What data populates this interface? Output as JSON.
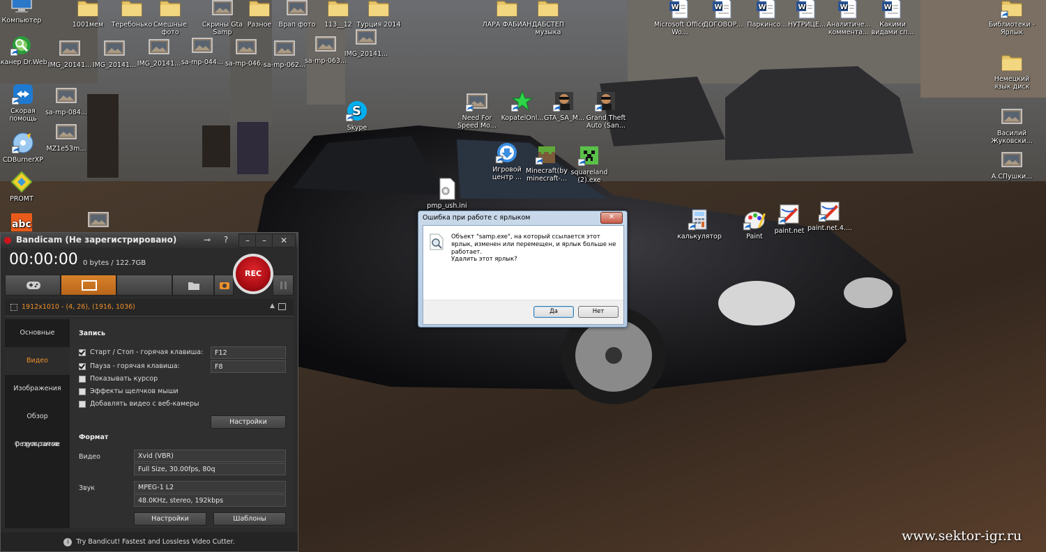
{
  "desktop": {
    "icons": [
      {
        "id": "computer",
        "label": "Компьютер"
      },
      {
        "id": "1001mem",
        "label": "1001мем"
      },
      {
        "id": "terebonko",
        "label": "Теребонько"
      },
      {
        "id": "funny",
        "label": "Смешные фото"
      },
      {
        "id": "gta-screens",
        "label": "Скрины Gta Samp"
      },
      {
        "id": "misc",
        "label": "Разное"
      },
      {
        "id": "vrap",
        "label": "Врап фото"
      },
      {
        "id": "113",
        "label": "113__12"
      },
      {
        "id": "turkey",
        "label": "Турция 2014"
      },
      {
        "id": "lara",
        "label": "ЛАРА ФАБИАН"
      },
      {
        "id": "dubstep",
        "label": "ДАБСТЕП музыка"
      },
      {
        "id": "msoffice",
        "label": "Microsoft Office Wo..."
      },
      {
        "id": "dogovor",
        "label": "ДОГОВОР..."
      },
      {
        "id": "parkinson",
        "label": "Паркинсо..."
      },
      {
        "id": "nutri",
        "label": "НУТРИЦЕ..."
      },
      {
        "id": "analit",
        "label": "Аналитиче... коммента..."
      },
      {
        "id": "kakimi",
        "label": "Какими видами сп..."
      },
      {
        "id": "libraries",
        "label": "Библиотеки - Ярлык"
      },
      {
        "id": "drweb",
        "label": "Сканер Dr.Web"
      },
      {
        "id": "img1",
        "label": "IMG_20141..."
      },
      {
        "id": "img2",
        "label": "IMG_20141..."
      },
      {
        "id": "img3",
        "label": "IMG_20141..."
      },
      {
        "id": "samp044",
        "label": "sa-mp-044..."
      },
      {
        "id": "samp046",
        "label": "sa-mp-046..."
      },
      {
        "id": "samp062",
        "label": "sa-mp-062..."
      },
      {
        "id": "samp063",
        "label": "sa-mp-063..."
      },
      {
        "id": "img4",
        "label": "IMG_20141..."
      },
      {
        "id": "german",
        "label": "Немецкий язык диск"
      },
      {
        "id": "teamviewer",
        "label": "Скорая помощь"
      },
      {
        "id": "samp084",
        "label": "sa-mp-084..."
      },
      {
        "id": "skype",
        "label": "Skype"
      },
      {
        "id": "nfs",
        "label": "Need For Speed Mo..."
      },
      {
        "id": "kopatel",
        "label": "KopatelOnl..."
      },
      {
        "id": "gtasam",
        "label": "GTA_SA_M..."
      },
      {
        "id": "gtasa",
        "label": "Grand Theft Auto (San..."
      },
      {
        "id": "vasily",
        "label": "Василий Жуковски..."
      },
      {
        "id": "cdburner",
        "label": "CDBurnerXP"
      },
      {
        "id": "mz1",
        "label": "MZ1e53m..."
      },
      {
        "id": "gamecenter",
        "label": "Игровой центр ..."
      },
      {
        "id": "minecraft",
        "label": "Minecraft(by minecraft-..."
      },
      {
        "id": "squareland",
        "label": "squareland (2).exe"
      },
      {
        "id": "pushkin",
        "label": "А.СПушки..."
      },
      {
        "id": "promt",
        "label": "PROMT"
      },
      {
        "id": "pmp",
        "label": "pmp_ush.ini"
      },
      {
        "id": "calc",
        "label": "калькулятор"
      },
      {
        "id": "paint",
        "label": "Paint"
      },
      {
        "id": "paintnet",
        "label": "paint.net"
      },
      {
        "id": "paintnet4",
        "label": "paint.net.4...."
      },
      {
        "id": "abc",
        "label": ""
      },
      {
        "id": "photo",
        "label": ""
      }
    ]
  },
  "bandicam": {
    "title": "Bandicam (Не зарегистрировано)",
    "timer": "00:00:00",
    "size": "0 bytes / 122.7GB",
    "rec_label": "REC",
    "region": "1912x1010 - (4, 26), (1916, 1036)",
    "sidebar": [
      "Основные",
      "Видео",
      "Изображения",
      "Обзор результатов",
      "О программе"
    ],
    "sidebar_active": "Видео",
    "record": {
      "heading": "Запись",
      "start_stop_label": "Старт / Стоп - горячая клавиша:",
      "start_stop_key": "F12",
      "pause_label": "Пауза - горячая клавиша:",
      "pause_key": "F8",
      "show_cursor": "Показывать курсор",
      "click_effects": "Эффекты щелчков мыши",
      "webcam": "Добавлять видео с веб-камеры",
      "settings_btn": "Настройки"
    },
    "format": {
      "heading": "Формат",
      "video_label": "Видео",
      "video_codec": "Xvid (VBR)",
      "video_detail": "Full Size, 30.00fps, 80q",
      "audio_label": "Звук",
      "audio_codec": "MPEG-1 L2",
      "audio_detail": "48.0KHz, stereo, 192kbps",
      "settings_btn": "Настройки",
      "templates_btn": "Шаблоны"
    },
    "footer": "Try Bandicut! Fastest and Lossless Video Cutter.",
    "titlebar_buttons": {
      "key": "⊸",
      "help": "?",
      "min": "–",
      "close": "✕"
    }
  },
  "dialog": {
    "title": "Ошибка при работе с ярлыком",
    "message": "Объект \"samp.exe\", на который ссылается этот ярлык, изменен или перемещен, и ярлык больше не работает.",
    "question": "Удалить этот ярлык?",
    "yes": "Да",
    "no": "Нет",
    "close": "✕"
  },
  "watermark": "www.sektor-igr.ru",
  "colors": {
    "accent_orange": "#f0902a",
    "rec_red": "#d0141c",
    "dialog_blue": "#b6cce3"
  }
}
